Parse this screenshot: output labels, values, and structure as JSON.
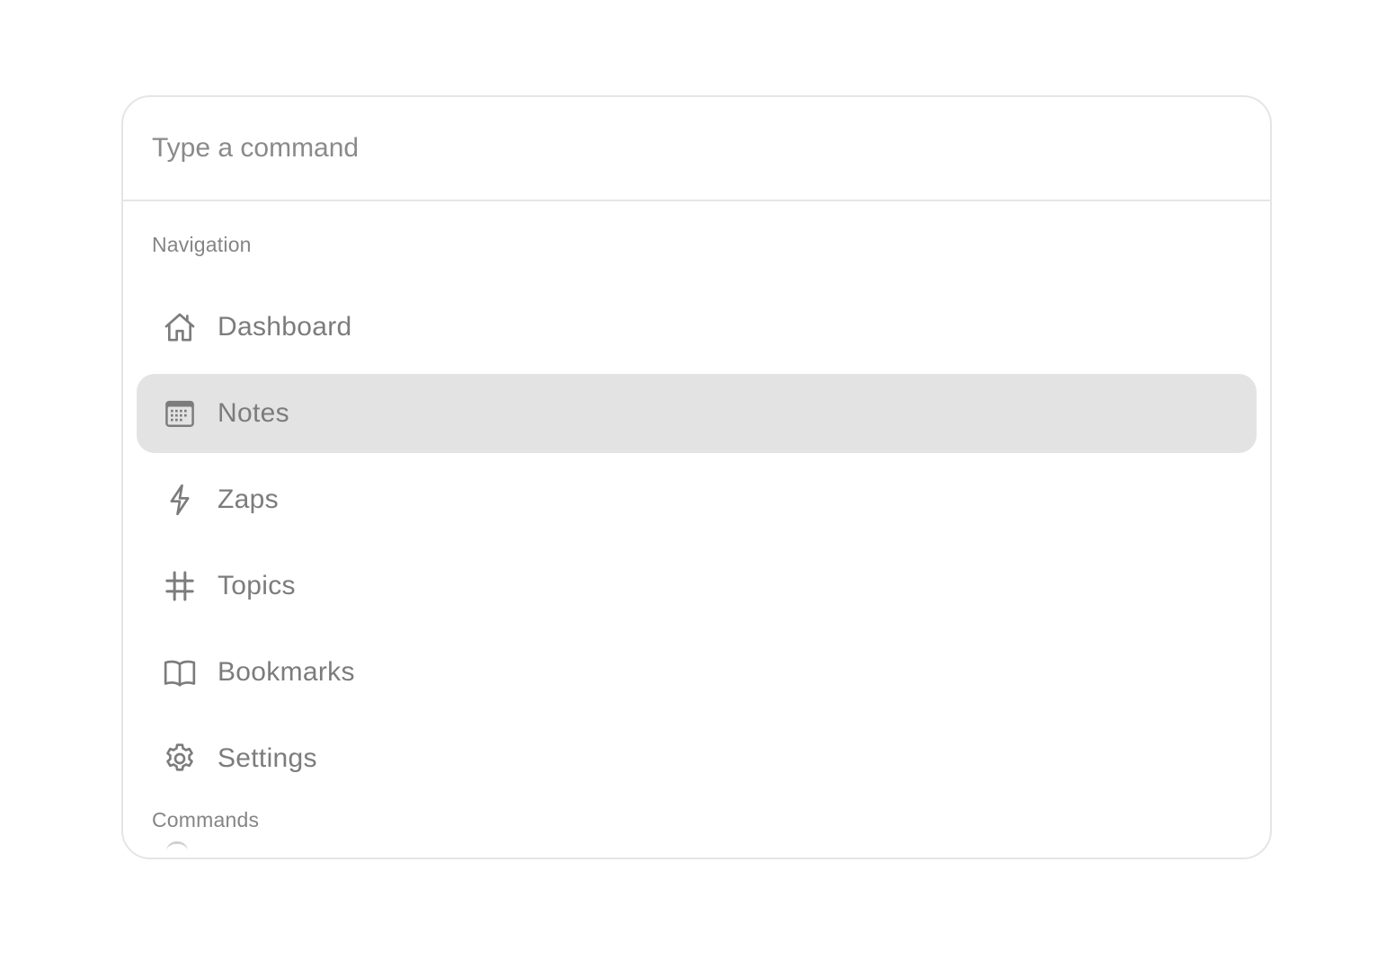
{
  "search": {
    "placeholder": "Type a command",
    "value": ""
  },
  "groups": {
    "navigation": {
      "heading": "Navigation",
      "items": [
        {
          "label": "Dashboard",
          "icon": "home-icon",
          "selected": false
        },
        {
          "label": "Notes",
          "icon": "calendar-icon",
          "selected": true
        },
        {
          "label": "Zaps",
          "icon": "lightning-icon",
          "selected": false
        },
        {
          "label": "Topics",
          "icon": "hashtag-icon",
          "selected": false
        },
        {
          "label": "Bookmarks",
          "icon": "book-open-icon",
          "selected": false
        },
        {
          "label": "Settings",
          "icon": "gear-icon",
          "selected": false
        }
      ]
    },
    "commands": {
      "heading": "Commands"
    }
  },
  "colors": {
    "border": "#e5e5e5",
    "selected_background": "#e3e3e3",
    "text": "#7c7c7c",
    "heading_text": "#858585",
    "placeholder": "#8a8a8a"
  }
}
